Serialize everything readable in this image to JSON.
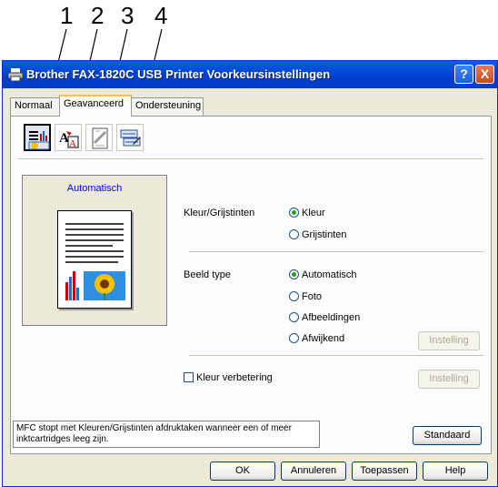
{
  "callouts": [
    "1",
    "2",
    "3",
    "4"
  ],
  "window": {
    "title": "Brother FAX-1820C USB Printer Voorkeursinstellingen",
    "help_button": "?",
    "close_button": "X"
  },
  "tabs": [
    {
      "label": "Normaal"
    },
    {
      "label": "Geavanceerd"
    },
    {
      "label": "Ondersteuning"
    }
  ],
  "toolbar": {
    "icons": [
      "print-quality-icon",
      "color-icon",
      "watermark-icon",
      "device-options-icon"
    ]
  },
  "preview": {
    "label": "Automatisch"
  },
  "color_section": {
    "label": "Kleur/Grijstinten",
    "options": [
      "Kleur",
      "Grijstinten"
    ],
    "selected": "Kleur"
  },
  "image_type_section": {
    "label": "Beeld type",
    "options": [
      "Automatisch",
      "Foto",
      "Afbeeldingen",
      "Afwijkend"
    ],
    "selected": "Automatisch",
    "settings_button": "Instelling"
  },
  "color_enhance": {
    "label": "Kleur verbetering",
    "checked": false,
    "settings_button": "Instelling"
  },
  "message": "MFC stopt met Kleuren/Grijstinten afdruktaken wanneer een of meer inktcartridges leeg zijn.",
  "buttons": {
    "default": "Standaard",
    "ok": "OK",
    "cancel": "Annuleren",
    "apply": "Toepassen",
    "help": "Help"
  }
}
